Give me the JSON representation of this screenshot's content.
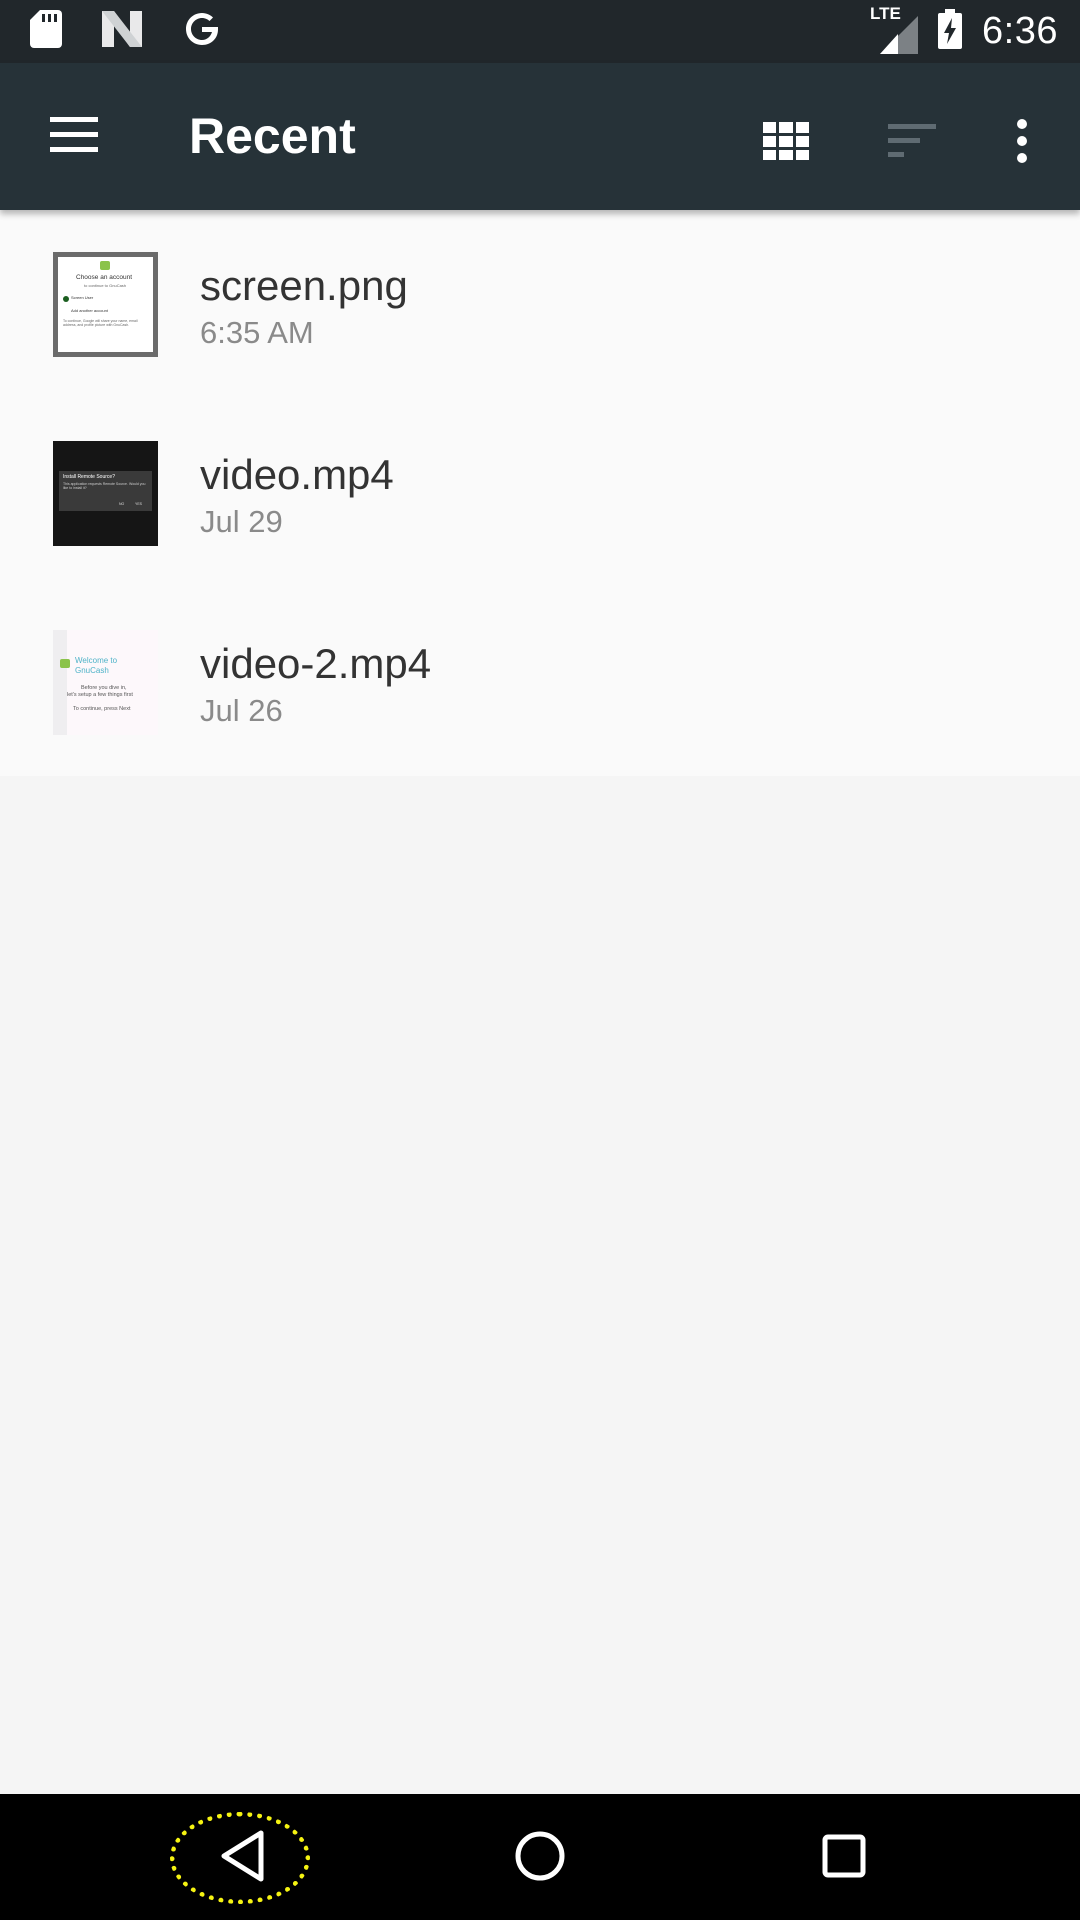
{
  "status_bar": {
    "time": "6:36",
    "network": "LTE",
    "icons": [
      "sd-card-icon",
      "n-icon",
      "google-icon",
      "signal-icon",
      "battery-charging-icon"
    ]
  },
  "app_bar": {
    "title": "Recent",
    "actions": [
      "menu-icon",
      "grid-view-icon",
      "sort-icon",
      "more-vert-icon"
    ]
  },
  "files": [
    {
      "name": "screen.png",
      "date": "6:35 AM",
      "thumbnail_text": [
        "Choose an account",
        "to continue to GnuCash",
        "Screen User",
        "Add another account",
        "To continue, Google will share your name, email address, and profile picture with GnuCash."
      ]
    },
    {
      "name": "video.mp4",
      "date": "Jul 29",
      "thumbnail_text": [
        "Install Remote Source?",
        "This application requests Remote Source. Would you like to install it?",
        "NO",
        "YES"
      ]
    },
    {
      "name": "video-2.mp4",
      "date": "Jul 26",
      "thumbnail_text": [
        "Welcome to",
        "GnuCash",
        "Before you dive in,",
        "let's setup a few things first",
        "To continue, press Next"
      ]
    }
  ],
  "nav_bar": {
    "buttons": [
      "back-icon",
      "home-icon",
      "recents-icon"
    ],
    "highlight_color": "#f5f312"
  },
  "colors": {
    "status_bar": "#21272b",
    "app_bar": "#263238",
    "list_bg": "#fafafa",
    "page_bg": "#f5f5f5"
  }
}
